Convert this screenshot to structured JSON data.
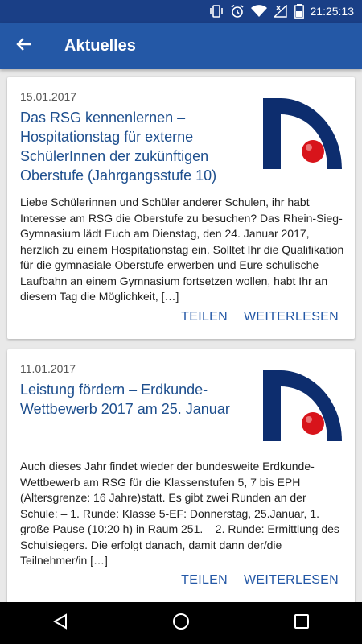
{
  "statusbar": {
    "time": "21:25:13"
  },
  "appbar": {
    "title": "Aktuelles"
  },
  "articles": [
    {
      "date": "15.01.2017",
      "title": "Das RSG kennenlernen – Hospitationstag für externe SchülerInnen der zukünftigen Oberstufe (Jahrgangsstufe 10)",
      "excerpt": "Liebe Schülerinnen und Schüler anderer Schulen, ihr habt Interesse am RSG die Oberstufe zu besuchen? Das Rhein-Sieg-Gymnasium lädt Euch am Dienstag, den 24. Januar 2017, herzlich zu einem Hospitationstag ein. Solltet Ihr die Qualifikation für die gymnasiale Oberstufe erwerben und Eure schulische Laufbahn an einem Gymnasium fortsetzen wollen, habt Ihr an diesem Tag die Möglichkeit, […]",
      "share_label": "TEILEN",
      "more_label": "WEITERLESEN"
    },
    {
      "date": "11.01.2017",
      "title": "Leistung fördern – Erdkunde-Wettbewerb 2017 am 25. Januar",
      "excerpt": "Auch dieses Jahr findet wieder der bundesweite Erdkunde-Wettbewerb am RSG für die Klassenstufen 5, 7 bis EPH (Altersgrenze: 16 Jahre)statt. Es gibt zwei Runden an der Schule: – 1. Runde: Klasse 5-EF: Donnerstag, 25.Januar, 1. große Pause (10:20 h) in Raum 251. – 2. Runde: Ermittlung des Schulsiegers. Die erfolgt danach, damit dann der/die Teilnehmer/in […]",
      "share_label": "TEILEN",
      "more_label": "WEITERLESEN"
    }
  ],
  "colors": {
    "appbar": "#2458a6",
    "statusbar": "#1a3f86",
    "accent": "#2458a6",
    "logo_navy": "#0d2d6e",
    "logo_red": "#d8141b"
  },
  "icons": [
    "vibrate-icon",
    "alarm-icon",
    "wifi-icon",
    "no-signal-icon",
    "battery-icon",
    "back-arrow-icon",
    "nav-back-icon",
    "nav-home-icon",
    "nav-recents-icon"
  ]
}
